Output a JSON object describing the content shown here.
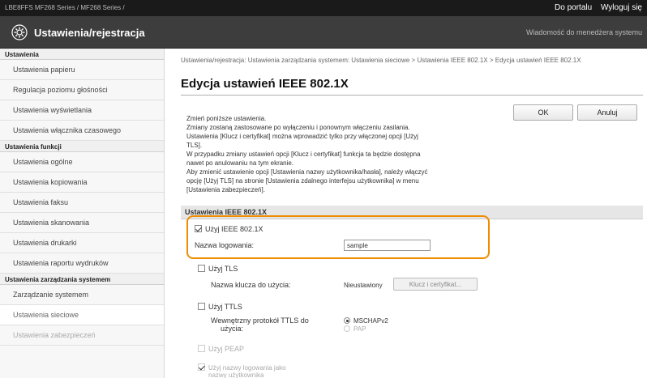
{
  "topbar": {
    "device": "LBE8FFS        MF268 Series / MF268 Series /",
    "portal_link": "Do portalu",
    "logout_link": "Wyloguj się"
  },
  "header": {
    "title": "Ustawienia/rejestracja",
    "admin_message": "Wiadomość do menedżera systemu"
  },
  "sidebar": {
    "groups": [
      {
        "title": "Ustawienia",
        "items": [
          "Ustawienia papieru",
          "Regulacja poziomu głośności",
          "Ustawienia wyświetlania",
          "Ustawienia włącznika czasowego"
        ]
      },
      {
        "title": "Ustawienia funkcji",
        "items": [
          "Ustawienia ogólne",
          "Ustawienia kopiowania",
          "Ustawienia faksu",
          "Ustawienia skanowania",
          "Ustawienia drukarki",
          "Ustawienia raportu wydruków"
        ]
      },
      {
        "title": "Ustawienia zarządzania systemem",
        "items": [
          "Zarządzanie systemem",
          "Ustawienia sieciowe",
          "Ustawienia zabezpieczeń"
        ]
      }
    ]
  },
  "main": {
    "breadcrumb": "Ustawienia/rejestracja: Ustawienia zarządzania systemem: Ustawienia sieciowe > Ustawienia IEEE 802.1X > Edycja ustawień IEEE 802.1X",
    "heading": "Edycja ustawień IEEE 802.1X",
    "description": [
      "Zmień poniższe ustawienia.",
      "Zmiany zostaną zastosowane po wyłączeniu i ponownym włączeniu zasilania.",
      "Ustawienia [Klucz i certyfikat] można wprowadzić tylko przy włączonej opcji [Użyj",
      "TLS].",
      "W przypadku zmiany ustawień opcji [Klucz i certyfikat] funkcja ta będzie dostępna",
      "nawet po anulowaniu na tym ekranie.",
      "Aby zmienić ustawienie opcji [Ustawienia nazwy użytkownika/hasła], należy włączyć",
      "opcję [Użyj TLS] na stronie [Ustawienia zdalnego interfejsu użytkownika] w menu",
      "[Ustawienia zabezpieczeń]."
    ],
    "ok_label": "OK",
    "cancel_label": "Anuluj",
    "section_title": "Ustawienia IEEE 802.1X",
    "use_ieee_label": "Użyj IEEE 802.1X",
    "use_ieee_checked": true,
    "login_name_label": "Nazwa logowania:",
    "login_name_value": "sample",
    "use_tls_label": "Użyj TLS",
    "key_name_label": "Nazwa klucza do użycia:",
    "key_name_value": "Nieustawiony",
    "key_cert_button": "Klucz i certyfikat...",
    "use_ttls_label": "Użyj TTLS",
    "ttls_protocol_label_1": "Wewnętrzny protokół TTLS do",
    "ttls_protocol_label_2": "użycia:",
    "ttls_options": [
      "MSCHAPv2",
      "PAP"
    ],
    "ttls_selected": "MSCHAPv2",
    "use_peap_label": "Użyj PEAP",
    "use_login_as_label_1": "Użyj nazwy logowania jako",
    "use_login_as_label_2": "nazwy użytkownika"
  },
  "colors": {
    "highlight": "#f08c00",
    "topbar": "#1a1a1a",
    "titlebar": "#3d3d3d"
  },
  "icons": {
    "settings": "gear-icon"
  }
}
